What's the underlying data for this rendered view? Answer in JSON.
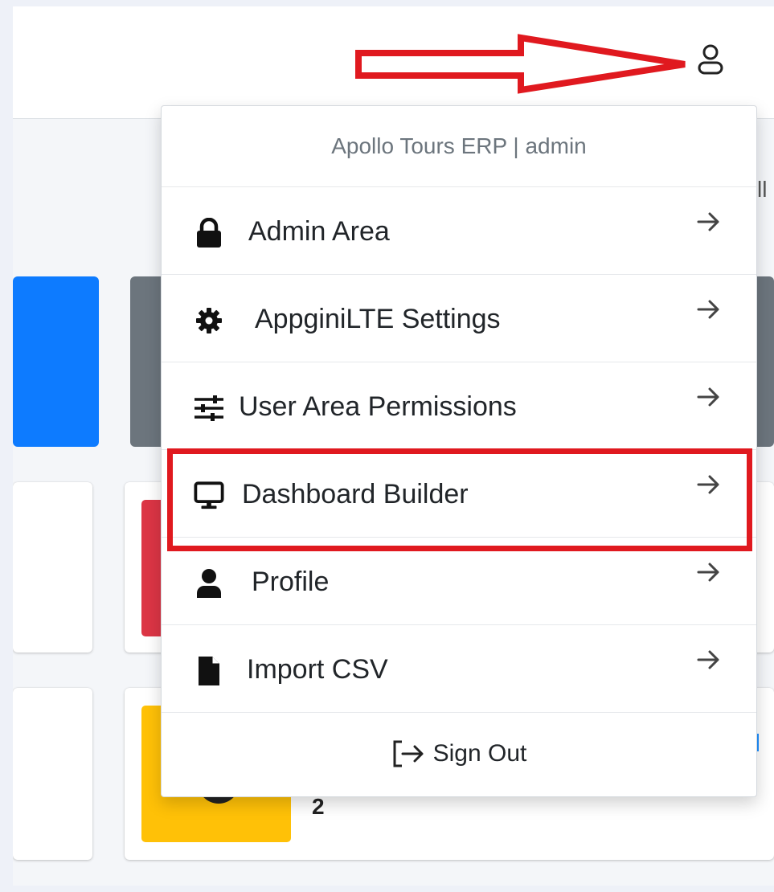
{
  "dropdown": {
    "header": "Apollo Tours ERP | admin",
    "items": [
      {
        "label": "Admin Area",
        "icon": "lock-icon"
      },
      {
        "label": "AppginiLTE Settings",
        "icon": "gear-icon"
      },
      {
        "label": "User Area Permissions",
        "icon": "sliders-icon"
      },
      {
        "label": "Dashboard Builder",
        "icon": "monitor-icon"
      },
      {
        "label": "Profile",
        "icon": "user-icon"
      },
      {
        "label": "Import CSV",
        "icon": "file-icon"
      }
    ],
    "footer": {
      "label": "Sign Out",
      "icon": "sign-out-icon"
    }
  },
  "navbar": {
    "user_icon": "user-outline-icon"
  },
  "background": {
    "card_number": "2",
    "peek_text": "ll"
  },
  "colors": {
    "annotation_red": "#e0191f",
    "tile_blue": "#0d7bff",
    "tile_gray": "#6c757d",
    "box_red": "#dc3545",
    "box_yellow": "#ffc107"
  }
}
